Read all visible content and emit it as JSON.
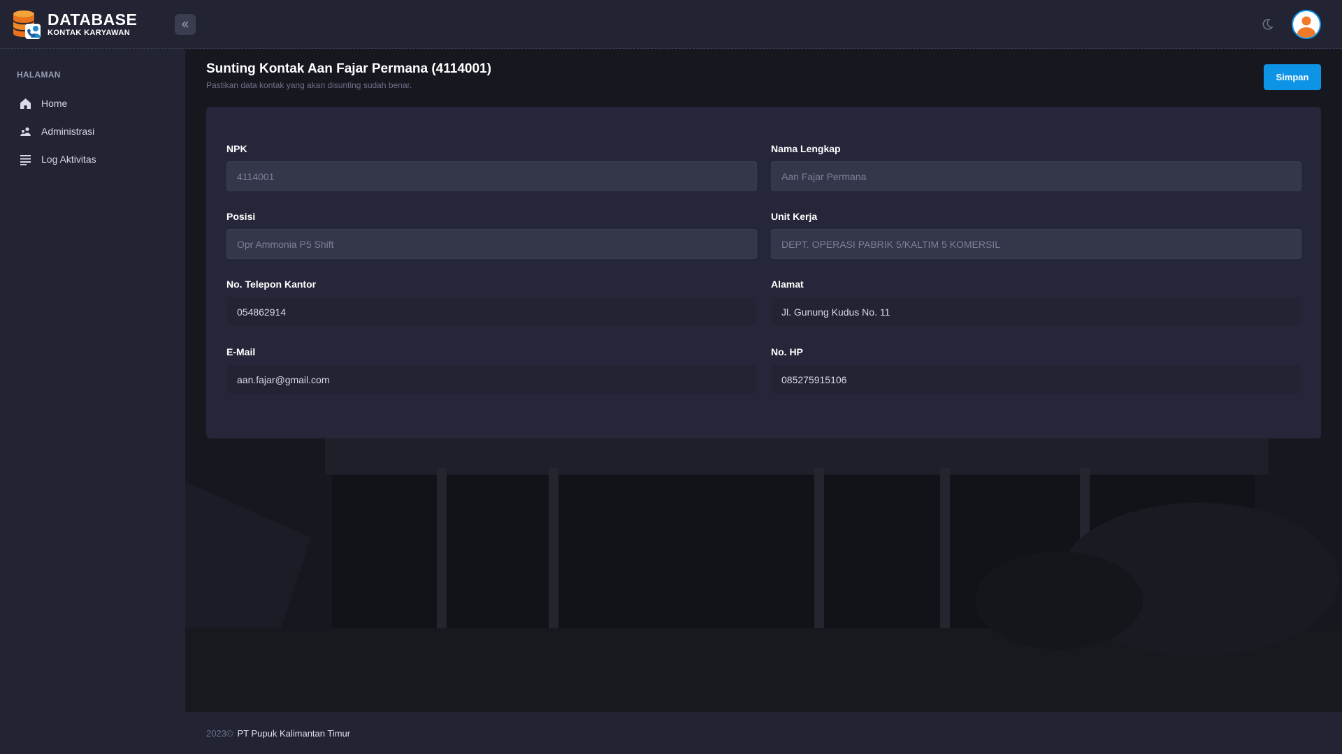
{
  "brand": {
    "title": "DATABASE",
    "subtitle": "KONTAK KARYAWAN"
  },
  "header": {
    "collapse_icon": "chevrons-left-icon",
    "theme_icon": "moon-icon",
    "avatar_icon": "user-avatar-icon"
  },
  "sidebar": {
    "heading": "HALAMAN",
    "items": [
      {
        "label": "Home",
        "icon": "home-icon"
      },
      {
        "label": "Administrasi",
        "icon": "users-icon"
      },
      {
        "label": "Log Aktivitas",
        "icon": "list-icon"
      }
    ]
  },
  "page": {
    "title": "Sunting Kontak Aan Fajar Permana (4114001)",
    "subtitle": "Pastikan data kontak yang akan disunting sudah benar.",
    "save_label": "Simpan"
  },
  "form": {
    "npk": {
      "label": "NPK",
      "value": "4114001"
    },
    "nama": {
      "label": "Nama Lengkap",
      "value": "Aan Fajar Permana"
    },
    "posisi": {
      "label": "Posisi",
      "value": "Opr Ammonia P5 Shift"
    },
    "unit": {
      "label": "Unit Kerja",
      "value": "DEPT. OPERASI PABRIK 5/KALTIM 5 KOMERSIL"
    },
    "telepon": {
      "label": "No. Telepon Kantor",
      "value": "054862914"
    },
    "alamat": {
      "label": "Alamat",
      "value": "Jl. Gunung Kudus No. 11"
    },
    "email": {
      "label": "E-Mail",
      "value": "aan.fajar@gmail.com"
    },
    "hp": {
      "label": "No. HP",
      "value": "085275915106"
    }
  },
  "footer": {
    "year": "2023©",
    "company": "PT Pupuk Kalimantan Timur"
  },
  "colors": {
    "accent": "#0d94e6",
    "logo_orange": "#f08a24",
    "sidebar_bg": "#222333",
    "content_bg": "#16171f"
  }
}
